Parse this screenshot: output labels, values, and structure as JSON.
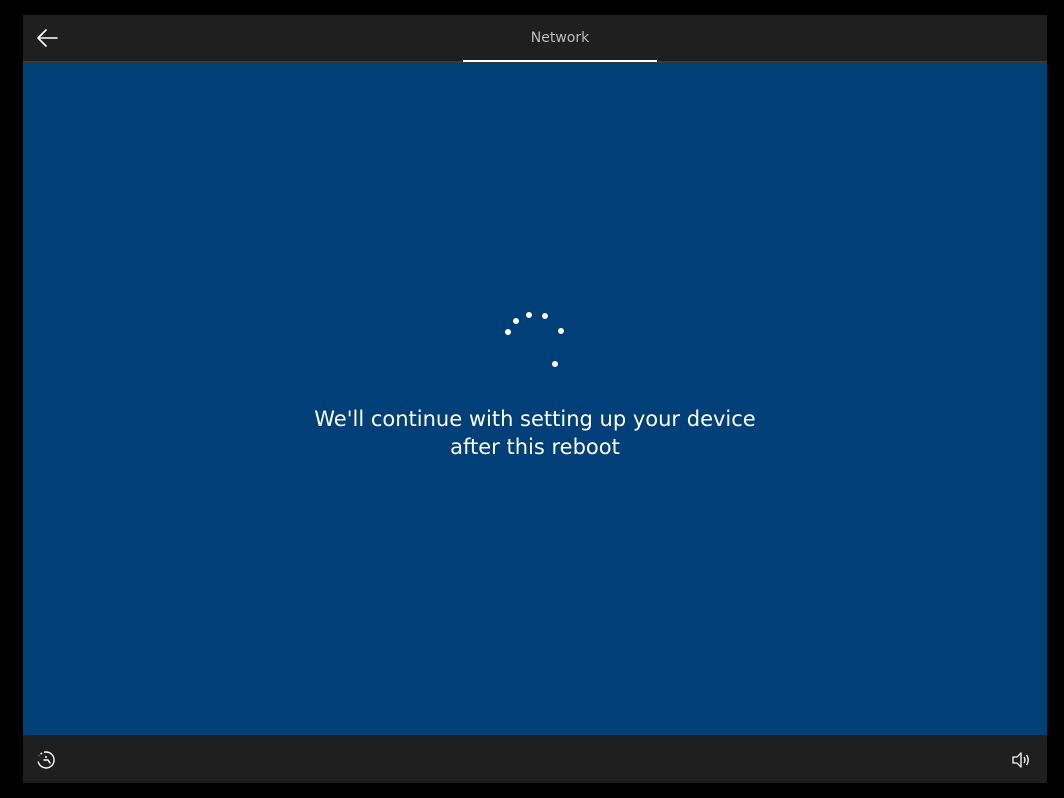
{
  "header": {
    "tab_label": "Network"
  },
  "main": {
    "message_line1": "We'll continue with setting up your device",
    "message_line2": "after this reboot"
  },
  "icons": {
    "back": "back-arrow-icon",
    "spinner": "loading-spinner-icon",
    "ease_of_access": "ease-of-access-icon",
    "volume": "volume-icon"
  },
  "colors": {
    "background_blue": "#003f77",
    "bar_dark": "#1f1f1f",
    "outer_black": "#000000",
    "text_white": "#ffffff",
    "tab_text_gray": "#bdbdbd"
  }
}
